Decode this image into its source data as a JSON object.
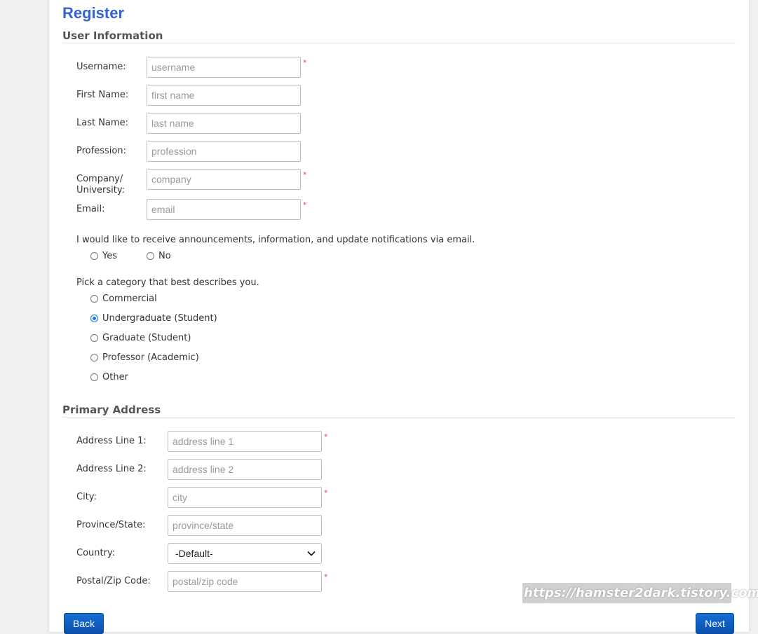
{
  "page": {
    "title": "Register"
  },
  "user_info": {
    "heading": "User Information",
    "fields": [
      {
        "label": "Username:",
        "placeholder": "username",
        "required": true
      },
      {
        "label": "First Name:",
        "placeholder": "first name",
        "required": false
      },
      {
        "label": "Last Name:",
        "placeholder": "last name",
        "required": false
      },
      {
        "label": "Profession:",
        "placeholder": "profession",
        "required": false
      },
      {
        "label_line1": "Company/",
        "label_line2": "University:",
        "placeholder": "company",
        "required": true
      },
      {
        "label": "Email:",
        "placeholder": "email",
        "required": true
      }
    ],
    "required_mark": "*",
    "notify_question": "I would like to receive announcements, information, and update notifications via email.",
    "notify_options": [
      {
        "label": "Yes",
        "checked": false
      },
      {
        "label": "No",
        "checked": false
      }
    ],
    "category_question": "Pick a category that best describes you.",
    "category_options": [
      {
        "label": "Commercial",
        "checked": false
      },
      {
        "label": "Undergraduate (Student)",
        "checked": true
      },
      {
        "label": "Graduate (Student)",
        "checked": false
      },
      {
        "label": "Professor (Academic)",
        "checked": false
      },
      {
        "label": "Other",
        "checked": false
      }
    ]
  },
  "address": {
    "heading": "Primary Address",
    "fields": [
      {
        "label": "Address Line 1:",
        "placeholder": "address line 1",
        "required": true
      },
      {
        "label": "Address Line 2:",
        "placeholder": "address line 2",
        "required": false
      },
      {
        "label": "City:",
        "placeholder": "city",
        "required": true
      },
      {
        "label": "Province/State:",
        "placeholder": "province/state",
        "required": false
      },
      {
        "label": "Country:",
        "selected": "-Default-"
      },
      {
        "label": "Postal/Zip Code:",
        "placeholder": "postal/zip code",
        "required": true
      }
    ]
  },
  "buttons": {
    "back": "Back",
    "next": "Next"
  },
  "watermark": "https://hamster2dark.tistory.com",
  "colors": {
    "title": "#3366cc",
    "required": "#d9534f",
    "button": "#0a5fc4",
    "radio_checked": "#1a73e8"
  }
}
